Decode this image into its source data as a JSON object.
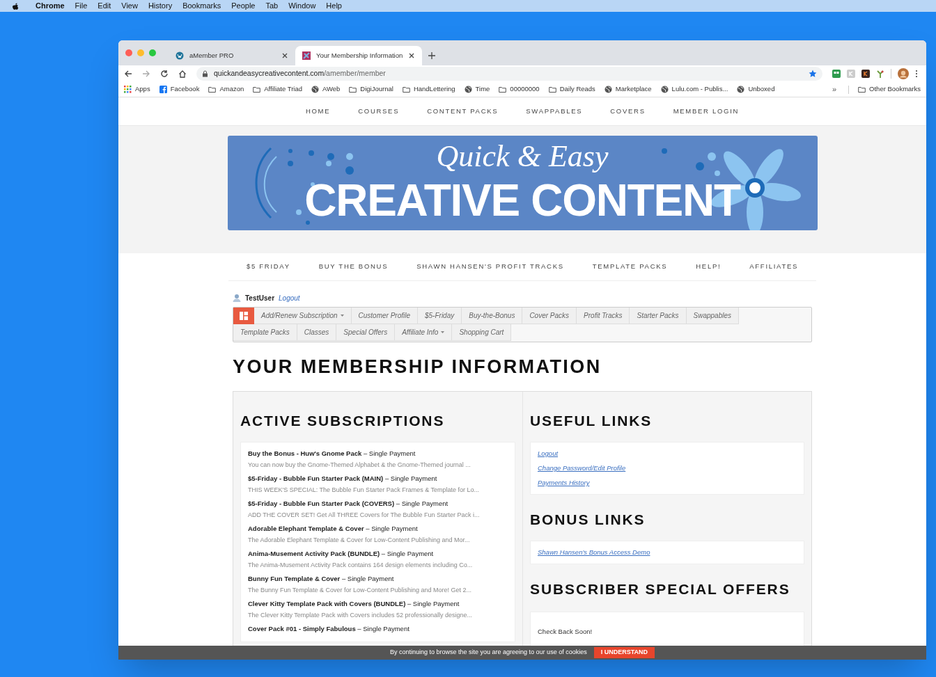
{
  "menu_bar": {
    "items": [
      {
        "label": "Chrome",
        "kind": "app"
      },
      {
        "label": "File",
        "kind": "menu"
      },
      {
        "label": "Edit",
        "kind": "menu"
      },
      {
        "label": "View",
        "kind": "menu"
      },
      {
        "label": "History",
        "kind": "menu"
      },
      {
        "label": "Bookmarks",
        "kind": "menu"
      },
      {
        "label": "People",
        "kind": "menu"
      },
      {
        "label": "Tab",
        "kind": "menu"
      },
      {
        "label": "Window",
        "kind": "menu"
      },
      {
        "label": "Help",
        "kind": "menu"
      }
    ]
  },
  "browser": {
    "tabs": [
      {
        "title": "aMember PRO",
        "kind": "wordpress",
        "selected": false
      },
      {
        "title": "Your Membership Information",
        "kind": "site",
        "selected": true
      }
    ],
    "address": {
      "host": "quickandeasycreativecontent.com",
      "path": "/amember/member",
      "bookmarked": true
    },
    "bookmarks": [
      {
        "label": "Apps",
        "kind": "apps"
      },
      {
        "label": "Facebook",
        "kind": "facebook"
      },
      {
        "label": "Amazon",
        "kind": "folder"
      },
      {
        "label": "Affiliate Triad",
        "kind": "folder"
      },
      {
        "label": "AWeb",
        "kind": "globe"
      },
      {
        "label": "DigiJournal",
        "kind": "folder"
      },
      {
        "label": "HandLettering",
        "kind": "folder"
      },
      {
        "label": "Time",
        "kind": "globe"
      },
      {
        "label": "00000000",
        "kind": "folder"
      },
      {
        "label": "Daily Reads",
        "kind": "folder"
      },
      {
        "label": "Marketplace",
        "kind": "globe"
      },
      {
        "label": "Lulu.com - Publis...",
        "kind": "globe"
      },
      {
        "label": "Unboxed",
        "kind": "globe"
      }
    ],
    "bookmarks_overflow": "»",
    "other_bookmarks": "Other Bookmarks"
  },
  "site": {
    "top_nav": [
      "HOME",
      "COURSES",
      "CONTENT PACKS",
      "SWAPPABLES",
      "COVERS",
      "MEMBER LOGIN"
    ],
    "banner": {
      "line_1": "Quick & Easy",
      "line_2": "CREATIVE CONTENT"
    },
    "secondary_nav": [
      "$5 FRIDAY",
      "BUY THE BONUS",
      "SHAWN HANSEN'S PROFIT TRACKS",
      "TEMPLATE PACKS",
      "HELP!",
      "AFFILIATES"
    ],
    "user": {
      "name": "TestUser",
      "logout": "Logout"
    },
    "member_menu_rows": [
      [
        {
          "label": "Add/Renew Subscription",
          "dropdown": true
        },
        {
          "label": "Customer Profile",
          "dropdown": false
        },
        {
          "label": "$5-Friday",
          "dropdown": false
        },
        {
          "label": "Buy-the-Bonus",
          "dropdown": false
        },
        {
          "label": "Cover Packs",
          "dropdown": false
        },
        {
          "label": "Profit Tracks",
          "dropdown": false
        },
        {
          "label": "Starter Packs",
          "dropdown": false
        },
        {
          "label": "Swappables",
          "dropdown": false
        }
      ],
      [
        {
          "label": "Template Packs",
          "dropdown": false
        },
        {
          "label": "Classes",
          "dropdown": false
        },
        {
          "label": "Special Offers",
          "dropdown": false
        },
        {
          "label": "Affiliate Info",
          "dropdown": true
        },
        {
          "label": "Shopping Cart",
          "dropdown": false
        }
      ]
    ],
    "page_title": "YOUR MEMBERSHIP INFORMATION",
    "active_subscriptions": {
      "title": "ACTIVE SUBSCRIPTIONS",
      "items": [
        {
          "name": "Buy the Bonus - Huw's Gnome Pack",
          "payment": "– Single Payment",
          "description": "You can now buy the Gnome-Themed Alphabet & the Gnome-Themed journal ..."
        },
        {
          "name": "$5-Friday - Bubble Fun Starter Pack (MAIN)",
          "payment": "– Single Payment",
          "description": "THIS WEEK'S SPECIAL: The Bubble Fun Starter Pack Frames & Template for Lo..."
        },
        {
          "name": "$5-Friday - Bubble Fun Starter Pack (COVERS)",
          "payment": "– Single Payment",
          "description": "ADD THE COVER SET! Get All THREE Covers for The Bubble Fun Starter Pack i..."
        },
        {
          "name": "Adorable Elephant Template & Cover",
          "payment": "– Single Payment",
          "description": "The Adorable Elephant Template & Cover for Low-Content Publishing and Mor..."
        },
        {
          "name": "Anima-Musement Activity Pack (BUNDLE)",
          "payment": "– Single Payment",
          "description": "The Anima-Musement Activity Pack contains 164 design elements including Co..."
        },
        {
          "name": "Bunny Fun Template & Cover",
          "payment": "– Single Payment",
          "description": "The Bunny Fun Template & Cover for Low-Content Publishing and More! Get 2..."
        },
        {
          "name": "Clever Kitty Template Pack with Covers (BUNDLE)",
          "payment": "– Single Payment",
          "description": "The Clever Kitty Template Pack with Covers includes 52 professionally designe..."
        },
        {
          "name": "Cover Pack #01 - Simply Fabulous",
          "payment": "– Single Payment"
        }
      ]
    },
    "useful_links": {
      "title": "USEFUL LINKS",
      "links": [
        "Logout",
        "Change Password/Edit Profile",
        "Payments History"
      ]
    },
    "bonus_links": {
      "title": "BONUS LINKS",
      "links": [
        "Shawn Hansen's Bonus Access Demo"
      ]
    },
    "special_offers": {
      "title": "SUBSCRIBER SPECIAL OFFERS",
      "text": "Check Back Soon!"
    },
    "cookie_bar": {
      "text": "By continuing to browse the site you are agreeing to our use of cookies",
      "button": "I UNDERSTAND"
    }
  }
}
